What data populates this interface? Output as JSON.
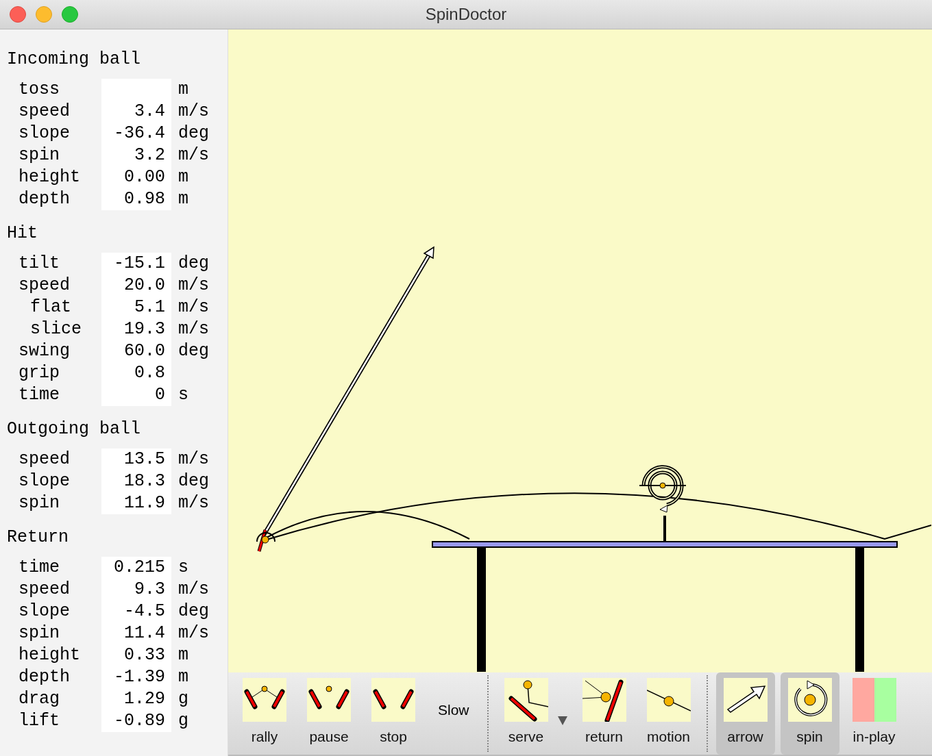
{
  "window": {
    "title": "SpinDoctor"
  },
  "sections": [
    {
      "title": "Incoming ball",
      "rows": [
        {
          "label": "toss",
          "value": "",
          "unit": "m"
        },
        {
          "label": "speed",
          "value": "3.4",
          "unit": "m/s"
        },
        {
          "label": "slope",
          "value": "-36.4",
          "unit": "deg"
        },
        {
          "label": "spin",
          "value": "3.2",
          "unit": "m/s"
        },
        {
          "label": "height",
          "value": "0.00",
          "unit": "m"
        },
        {
          "label": "depth",
          "value": "0.98",
          "unit": "m"
        }
      ]
    },
    {
      "title": "Hit",
      "rows": [
        {
          "label": "tilt",
          "value": "-15.1",
          "unit": "deg"
        },
        {
          "label": "speed",
          "value": "20.0",
          "unit": "m/s",
          "children": [
            {
              "label": "flat",
              "value": "5.1",
              "unit": "m/s"
            },
            {
              "label": "slice",
              "value": "19.3",
              "unit": "m/s"
            }
          ]
        },
        {
          "label": "swing",
          "value": "60.0",
          "unit": "deg"
        },
        {
          "label": "grip",
          "value": "0.8"
        },
        {
          "label": "time",
          "value": "0",
          "unit": "s"
        }
      ]
    },
    {
      "title": "Outgoing ball",
      "rows": [
        {
          "label": "speed",
          "value": "13.5",
          "unit": "m/s"
        },
        {
          "label": "slope",
          "value": "18.3",
          "unit": "deg"
        },
        {
          "label": "spin",
          "value": "11.9",
          "unit": "m/s"
        }
      ]
    },
    {
      "title": "Return",
      "rows": [
        {
          "label": "time",
          "value": "0.215",
          "unit": "s"
        },
        {
          "label": "speed",
          "value": "9.3",
          "unit": "m/s"
        },
        {
          "label": "slope",
          "value": "-4.5",
          "unit": "deg"
        },
        {
          "label": "spin",
          "value": "11.4",
          "unit": "m/s"
        },
        {
          "label": "height",
          "value": "0.33",
          "unit": "m"
        },
        {
          "label": "depth",
          "value": "-1.39",
          "unit": "m"
        },
        {
          "label": "drag",
          "value": "1.29",
          "unit": "g"
        },
        {
          "label": "lift",
          "value": "-0.89",
          "unit": "g"
        }
      ]
    }
  ],
  "toolbar": [
    [
      {
        "kind": "rally",
        "label": "rally"
      },
      {
        "kind": "pause",
        "label": "pause"
      },
      {
        "kind": "stop",
        "label": "stop"
      },
      {
        "kind": "text",
        "label": "Slow"
      }
    ],
    [
      {
        "kind": "serve",
        "label": "serve",
        "menu": true
      },
      {
        "kind": "return",
        "label": "return"
      },
      {
        "kind": "motion",
        "label": "motion"
      }
    ],
    [
      {
        "kind": "arrow",
        "label": "arrow",
        "selected": true
      },
      {
        "kind": "spin",
        "label": "spin",
        "selected": true
      },
      {
        "kind": "inplay",
        "label": "in-play"
      }
    ]
  ]
}
